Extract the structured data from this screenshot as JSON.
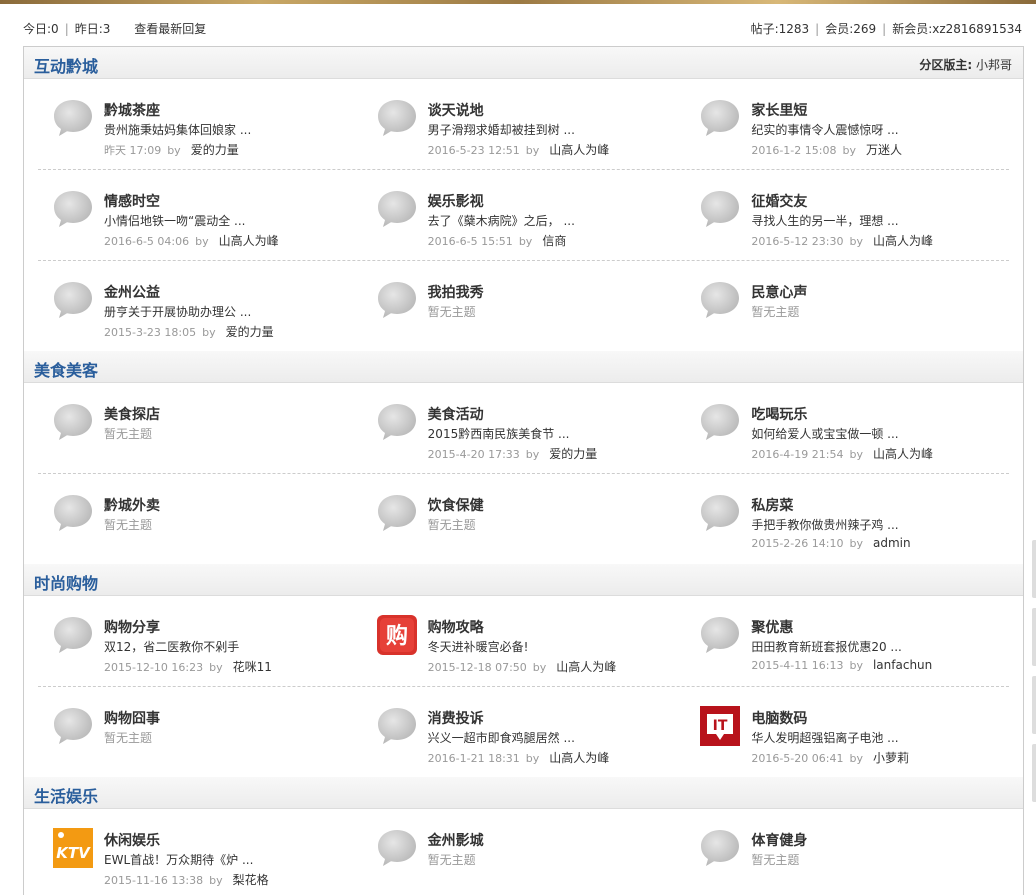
{
  "stats": {
    "today": "今日:0",
    "yesterday": "昨日:3",
    "latest_link": "查看最新回复",
    "posts": "帖子:1283",
    "members": "会员:269",
    "new_member": "新会员:xz2816891534"
  },
  "colors": {
    "category_title": "#2a5e9c",
    "meta_gray": "#999999"
  },
  "categories": [
    {
      "title": "互动黔城",
      "moderator_label": "分区版主:",
      "moderator": "小邦哥",
      "rows": [
        [
          {
            "name": "黔城茶座",
            "icon": "speech-bubble-icon",
            "last": "贵州施秉姑妈集体回娘家 ...",
            "date": "昨天  17:09",
            "by": "by",
            "author": "爱的力量"
          },
          {
            "name": "谈天说地",
            "icon": "speech-bubble-icon",
            "last": "男子滑翔求婚却被挂到树 ...",
            "date": "2016-5-23 12:51",
            "by": "by",
            "author": "山高人为峰"
          },
          {
            "name": "家长里短",
            "icon": "speech-bubble-icon",
            "last": "纪实的事情令人震憾惊呀 ...",
            "date": "2016-1-2 15:08",
            "by": "by",
            "author": "万迷人"
          }
        ],
        [
          {
            "name": "情感时空",
            "icon": "speech-bubble-icon",
            "last": "小情侣地铁一吻“震动全 ...",
            "date": "2016-6-5 04:06",
            "by": "by",
            "author": "山高人为峰"
          },
          {
            "name": "娱乐影视",
            "icon": "speech-bubble-icon",
            "last": "去了《蘖木病院》之后， ...",
            "date": "2016-6-5 15:51",
            "by": "by",
            "author": "信商"
          },
          {
            "name": "征婚交友",
            "icon": "speech-bubble-icon",
            "last": "寻找人生的另一半，理想 ...",
            "date": "2016-5-12 23:30",
            "by": "by",
            "author": "山高人为峰"
          }
        ],
        [
          {
            "name": "金州公益",
            "icon": "speech-bubble-icon",
            "last": "册亨关于开展协助办理公 ...",
            "date": "2015-3-23 18:05",
            "by": "by",
            "author": "爱的力量"
          },
          {
            "name": "我拍我秀",
            "icon": "speech-bubble-icon",
            "empty": "暂无主题"
          },
          {
            "name": "民意心声",
            "icon": "speech-bubble-icon",
            "empty": "暂无主题"
          }
        ]
      ]
    },
    {
      "title": "美食美客",
      "rows": [
        [
          {
            "name": "美食探店",
            "icon": "speech-bubble-icon",
            "empty": "暂无主题"
          },
          {
            "name": "美食活动",
            "icon": "speech-bubble-icon",
            "last": "2015黔西南民族美食节 ...",
            "date": "2015-4-20 17:33",
            "by": "by",
            "author": "爱的力量"
          },
          {
            "name": "吃喝玩乐",
            "icon": "speech-bubble-icon",
            "last": "如何给爱人或宝宝做一顿 ...",
            "date": "2016-4-19 21:54",
            "by": "by",
            "author": "山高人为峰"
          }
        ],
        [
          {
            "name": "黔城外卖",
            "icon": "speech-bubble-icon",
            "empty": "暂无主题"
          },
          {
            "name": "饮食保健",
            "icon": "speech-bubble-icon",
            "empty": "暂无主题"
          },
          {
            "name": "私房菜",
            "icon": "speech-bubble-icon",
            "last": "手把手教你做贵州辣子鸡 ...",
            "date": "2015-2-26 14:10",
            "by": "by",
            "author": "admin"
          }
        ]
      ]
    },
    {
      "title": "时尚购物",
      "rows": [
        [
          {
            "name": "购物分享",
            "icon": "speech-bubble-icon",
            "last": "双12，省二医教你不剁手",
            "date": "2015-12-10 16:23",
            "by": "by",
            "author": "花咪11"
          },
          {
            "name": "购物攻略",
            "icon": "shopping-logo-icon",
            "logo_text": "购",
            "last": "冬天进补暖宫必备!",
            "date": "2015-12-18 07:50",
            "by": "by",
            "author": "山高人为峰"
          },
          {
            "name": "聚优惠",
            "icon": "speech-bubble-icon",
            "last": "田田教育新班套报优惠20 ...",
            "date": "2015-4-11 16:13",
            "by": "by",
            "author": "lanfachun"
          }
        ],
        [
          {
            "name": "购物囧事",
            "icon": "speech-bubble-icon",
            "empty": "暂无主题"
          },
          {
            "name": "消费投诉",
            "icon": "speech-bubble-icon",
            "last": "兴义一超市即食鸡腿居然 ...",
            "date": "2016-1-21 18:31",
            "by": "by",
            "author": "山高人为峰"
          },
          {
            "name": "电脑数码",
            "icon": "it-logo-icon",
            "logo_text": "IT",
            "last": "华人发明超强铝离子电池 ...",
            "date": "2016-5-20 06:41",
            "by": "by",
            "author": "小萝莉"
          }
        ]
      ]
    },
    {
      "title": "生活娱乐",
      "rows": [
        [
          {
            "name": "休闲娱乐",
            "icon": "ktv-logo-icon",
            "logo_text": "KTV",
            "last": "EWL首战！万众期待《炉 ...",
            "date": "2015-11-16 13:38",
            "by": "by",
            "author": "梨花格"
          },
          {
            "name": "金州影城",
            "icon": "speech-bubble-icon",
            "empty": "暂无主题"
          },
          {
            "name": "体育健身",
            "icon": "speech-bubble-icon",
            "empty": "暂无主题"
          }
        ]
      ]
    }
  ]
}
